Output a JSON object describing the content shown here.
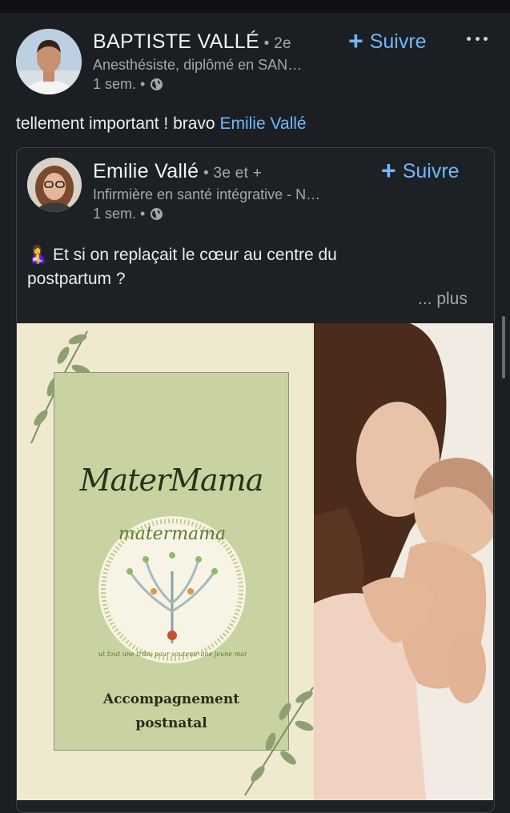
{
  "author": {
    "name": "BAPTISTE VALLÉ",
    "degree": " • 2e",
    "headline": "Anesthésiste, diplômé en SAN…",
    "time": "1 sem. •",
    "follow_label": "Suivre"
  },
  "comment": {
    "text": "tellement important ! bravo ",
    "mention": "Emilie Vallé"
  },
  "shared": {
    "name": "Emilie Vallé",
    "degree": " • 3e et +",
    "headline": "Infirmière en santé intégrative - N…",
    "time": "1 sem. •",
    "follow_label": "Suivre",
    "emoji": "🤱",
    "text": "Et si on replaçait le cœur au centre du postpartum ?",
    "more_label": "... plus"
  },
  "image": {
    "brand_title": "MaterMama",
    "logo_top_text": "matermama",
    "logo_ring_text": "il faut tout une tribu pour soutenir une jeune maman",
    "caption_line1": "Accompagnement",
    "caption_line2": "postnatal"
  },
  "colors": {
    "background": "#1b1f23",
    "link": "#71b7fb",
    "panel_cream": "#efe9cf",
    "panel_green": "#c9d2a1"
  },
  "icons": [
    "globe-icon",
    "plus-icon",
    "more-icon"
  ]
}
